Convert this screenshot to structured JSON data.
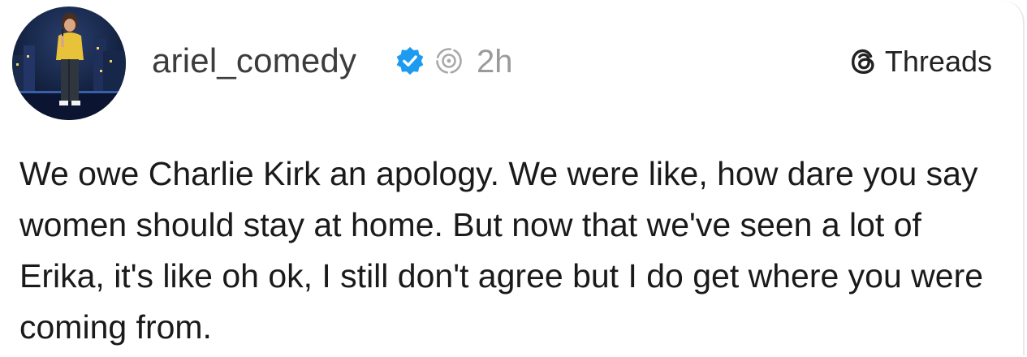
{
  "post": {
    "username": "ariel_comedy",
    "verified": true,
    "time": "2h",
    "text": "We owe Charlie Kirk an apology. We were like, how dare you say women should stay at home. But now that we've seen a lot of Erika, it's like oh ok, I still don't agree but I do get where you were coming from."
  },
  "platform": {
    "name": "Threads"
  },
  "colors": {
    "verified_badge": "#1d9bf0",
    "username": "#3c3c3c",
    "time": "#9a9a9a",
    "text": "#1a1a1a"
  },
  "icons": {
    "avatar": "profile-photo",
    "verified": "verified-badge-icon",
    "repost": "repost-icon",
    "brand": "threads-logo-icon"
  }
}
